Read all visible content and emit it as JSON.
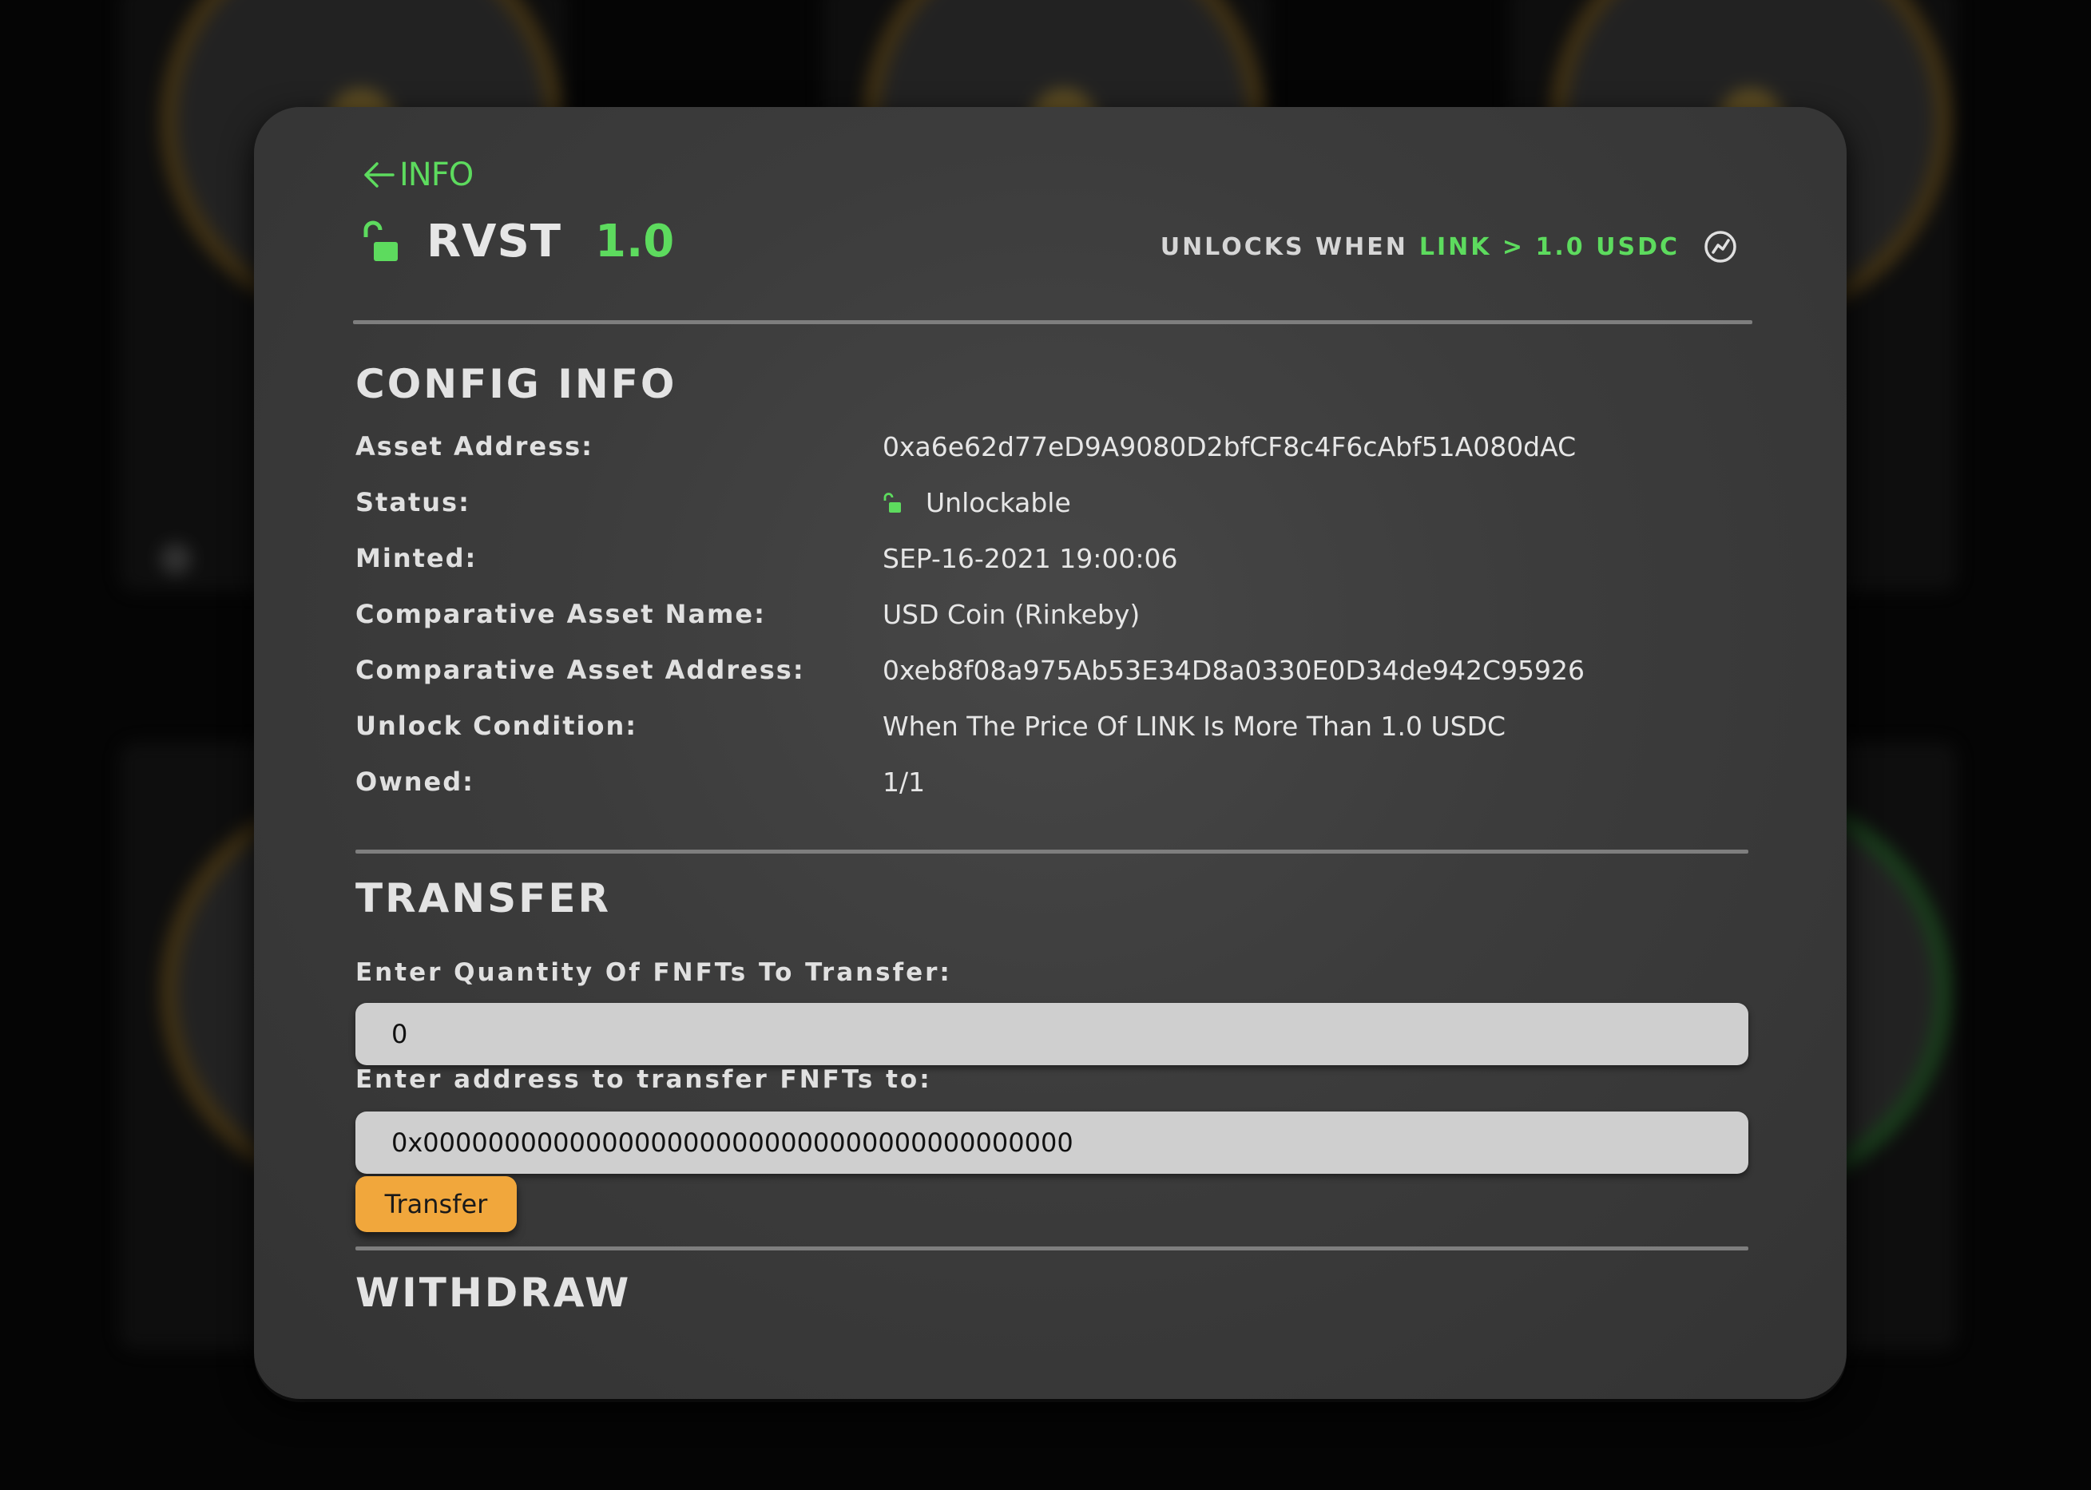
{
  "header": {
    "back_label": "INFO",
    "token_name": "RVST",
    "token_value": "1.0",
    "unlocks_label": "UNLOCKS WHEN",
    "unlocks_condition": "LINK > 1.0 USDC"
  },
  "config": {
    "title": "CONFIG INFO",
    "rows": [
      {
        "label": "Asset Address:",
        "value": "0xa6e62d77eD9A9080D2bfCF8c4F6cAbf51A080dAC"
      },
      {
        "label": "Status:",
        "value": "Unlockable"
      },
      {
        "label": "Minted:",
        "value": "SEP-16-2021 19:00:06"
      },
      {
        "label": "Comparative Asset Name:",
        "value": "USD Coin (Rinkeby)"
      },
      {
        "label": "Comparative Asset Address:",
        "value": "0xeb8f08a975Ab53E34D8a0330E0D34de942C95926"
      },
      {
        "label": "Unlock Condition:",
        "value": "When The Price Of LINK Is More Than 1.0 USDC"
      },
      {
        "label": "Owned:",
        "value": "1/1"
      }
    ]
  },
  "transfer": {
    "title": "TRANSFER",
    "quantity_label": "Enter Quantity Of FNFTs To Transfer:",
    "quantity_value": "0",
    "address_label": "Enter address to transfer FNFTs to:",
    "address_value": "0x0000000000000000000000000000000000000000",
    "button_label": "Transfer"
  },
  "withdraw": {
    "title": "WITHDRAW"
  },
  "colors": {
    "accent_green": "#5ddb5e",
    "button_orange": "#f1a73c",
    "modal_bg": "#3c3c3c"
  },
  "icons": {
    "back": "arrow-left-icon",
    "lock": "unlocked-padlock-icon",
    "chart": "price-chart-icon"
  }
}
